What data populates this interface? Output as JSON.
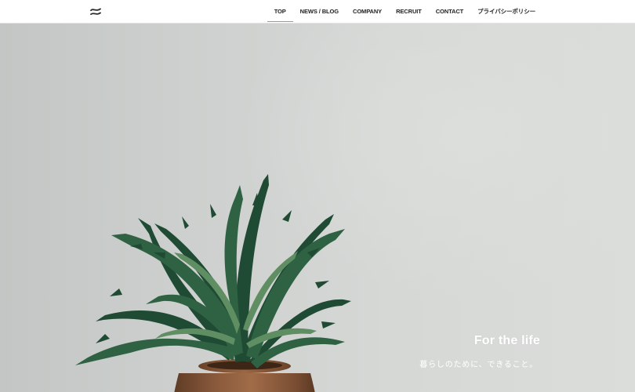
{
  "header": {
    "logo_icon": "wave-logo-icon",
    "nav": [
      {
        "label": "TOP",
        "active": true
      },
      {
        "label": "NEWS / BLOG",
        "active": false
      },
      {
        "label": "COMPANY",
        "active": false
      },
      {
        "label": "RECRUIT",
        "active": false
      },
      {
        "label": "CONTACT",
        "active": false
      },
      {
        "label": "プライバシーポリシー",
        "active": false
      }
    ]
  },
  "hero": {
    "title": "For the life",
    "subtitle": "暮らしのために、できること。",
    "image_subject": "potted-plant-image"
  },
  "colors": {
    "background": "#d6d8d6",
    "text_on_hero": "#ffffff",
    "nav_text": "#222222",
    "leaf_dark": "#1f4a33",
    "leaf_light": "#5f8e63",
    "pot": "#8a5a3c"
  }
}
